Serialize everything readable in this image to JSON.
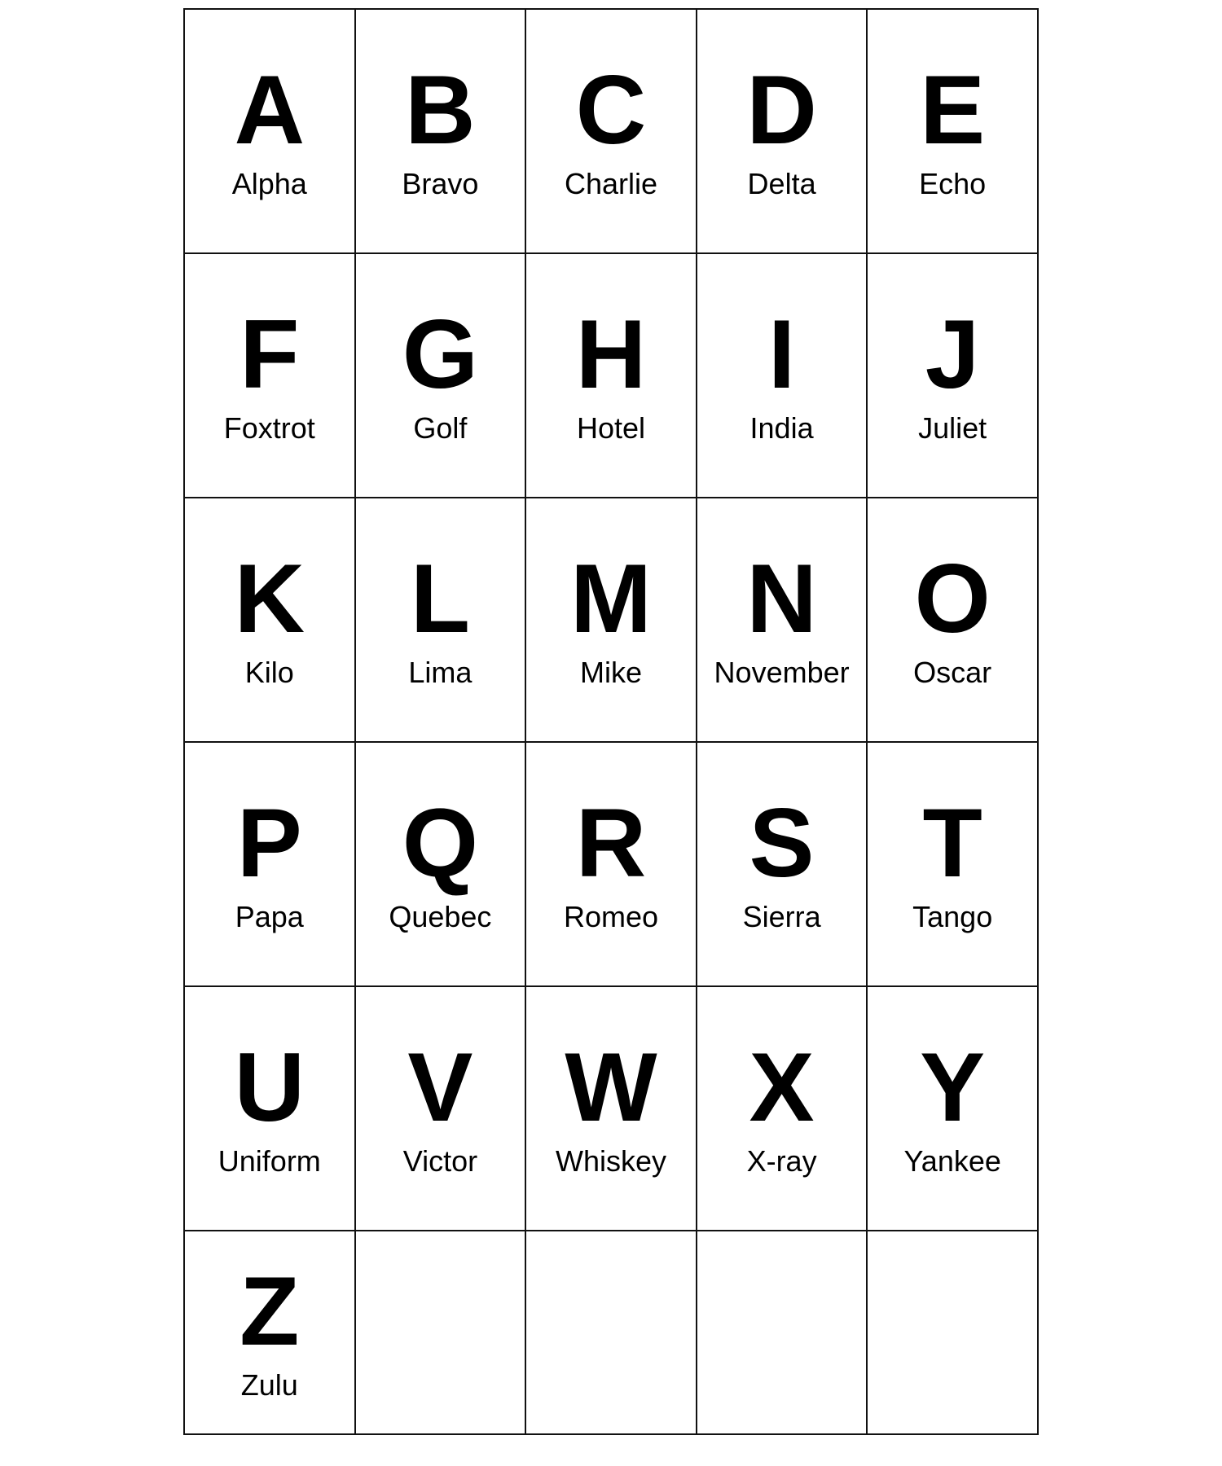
{
  "alphabet": [
    {
      "letter": "A",
      "name": "Alpha"
    },
    {
      "letter": "B",
      "name": "Bravo"
    },
    {
      "letter": "C",
      "name": "Charlie"
    },
    {
      "letter": "D",
      "name": "Delta"
    },
    {
      "letter": "E",
      "name": "Echo"
    },
    {
      "letter": "F",
      "name": "Foxtrot"
    },
    {
      "letter": "G",
      "name": "Golf"
    },
    {
      "letter": "H",
      "name": "Hotel"
    },
    {
      "letter": "I",
      "name": "India"
    },
    {
      "letter": "J",
      "name": "Juliet"
    },
    {
      "letter": "K",
      "name": "Kilo"
    },
    {
      "letter": "L",
      "name": "Lima"
    },
    {
      "letter": "M",
      "name": "Mike"
    },
    {
      "letter": "N",
      "name": "November"
    },
    {
      "letter": "O",
      "name": "Oscar"
    },
    {
      "letter": "P",
      "name": "Papa"
    },
    {
      "letter": "Q",
      "name": "Quebec"
    },
    {
      "letter": "R",
      "name": "Romeo"
    },
    {
      "letter": "S",
      "name": "Sierra"
    },
    {
      "letter": "T",
      "name": "Tango"
    },
    {
      "letter": "U",
      "name": "Uniform"
    },
    {
      "letter": "V",
      "name": "Victor"
    },
    {
      "letter": "W",
      "name": "Whiskey"
    },
    {
      "letter": "X",
      "name": "X-ray"
    },
    {
      "letter": "Y",
      "name": "Yankee"
    },
    {
      "letter": "Z",
      "name": "Zulu"
    }
  ]
}
